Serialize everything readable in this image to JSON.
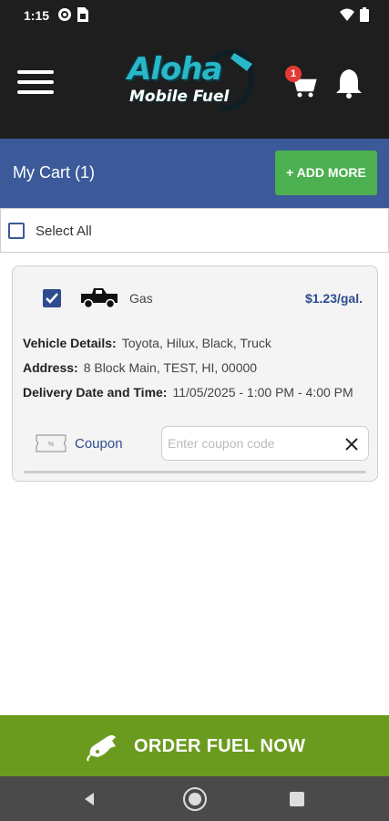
{
  "status_bar": {
    "time": "1:15"
  },
  "header": {
    "logo_line1": "Aloha",
    "logo_line2": "Mobile Fuel",
    "cart_count": "1"
  },
  "cart_bar": {
    "title": "My Cart (1)",
    "add_more_label": "+ ADD MORE"
  },
  "select_all": {
    "label": "Select All",
    "checked": false
  },
  "cart_item": {
    "checked": true,
    "fuel_type": "Gas",
    "price": "$1.23/gal.",
    "vehicle_label": "Vehicle Details:",
    "vehicle_value": "Toyota, Hilux, Black, Truck",
    "address_label": "Address:",
    "address_value": "8 Block Main, TEST, HI, 00000",
    "delivery_label": "Delivery Date and Time:",
    "delivery_value": "11/05/2025 - 1:00 PM - 4:00 PM",
    "coupon_label": "Coupon",
    "coupon_placeholder": "Enter coupon code",
    "coupon_value": ""
  },
  "order_button": {
    "label": "ORDER FUEL NOW"
  },
  "colors": {
    "brand_blue": "#3c5a9a",
    "accent_green": "#4caf50",
    "order_green": "#6b9b1e",
    "header_dark": "#1e1e1e"
  },
  "icons": [
    "menu-icon",
    "cart-icon",
    "bell-icon",
    "truck-icon",
    "coupon-icon",
    "clear-icon",
    "fuel-nozzle-icon",
    "back-icon",
    "home-icon",
    "recents-icon"
  ]
}
